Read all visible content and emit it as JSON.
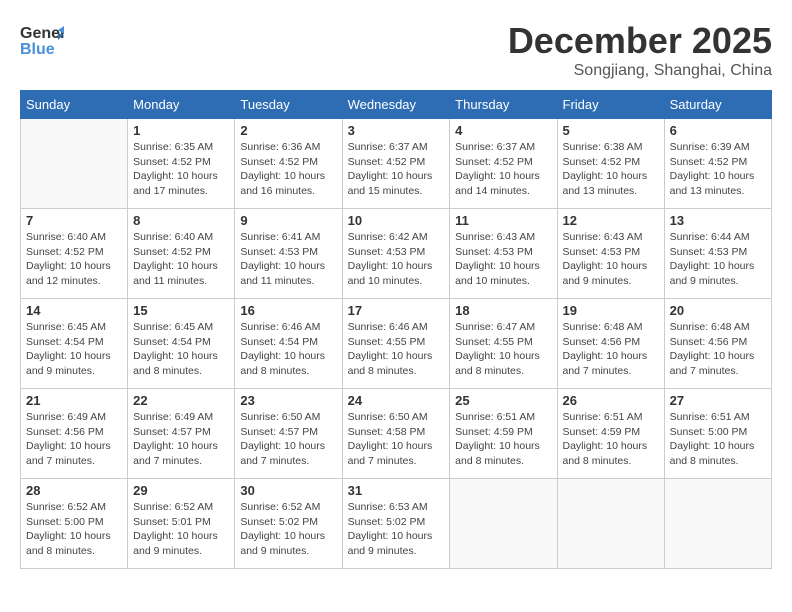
{
  "header": {
    "logo_general": "General",
    "logo_blue": "Blue",
    "month": "December 2025",
    "location": "Songjiang, Shanghai, China"
  },
  "days_of_week": [
    "Sunday",
    "Monday",
    "Tuesday",
    "Wednesday",
    "Thursday",
    "Friday",
    "Saturday"
  ],
  "weeks": [
    [
      {
        "day": "",
        "info": ""
      },
      {
        "day": "1",
        "info": "Sunrise: 6:35 AM\nSunset: 4:52 PM\nDaylight: 10 hours\nand 17 minutes."
      },
      {
        "day": "2",
        "info": "Sunrise: 6:36 AM\nSunset: 4:52 PM\nDaylight: 10 hours\nand 16 minutes."
      },
      {
        "day": "3",
        "info": "Sunrise: 6:37 AM\nSunset: 4:52 PM\nDaylight: 10 hours\nand 15 minutes."
      },
      {
        "day": "4",
        "info": "Sunrise: 6:37 AM\nSunset: 4:52 PM\nDaylight: 10 hours\nand 14 minutes."
      },
      {
        "day": "5",
        "info": "Sunrise: 6:38 AM\nSunset: 4:52 PM\nDaylight: 10 hours\nand 13 minutes."
      },
      {
        "day": "6",
        "info": "Sunrise: 6:39 AM\nSunset: 4:52 PM\nDaylight: 10 hours\nand 13 minutes."
      }
    ],
    [
      {
        "day": "7",
        "info": "Sunrise: 6:40 AM\nSunset: 4:52 PM\nDaylight: 10 hours\nand 12 minutes."
      },
      {
        "day": "8",
        "info": "Sunrise: 6:40 AM\nSunset: 4:52 PM\nDaylight: 10 hours\nand 11 minutes."
      },
      {
        "day": "9",
        "info": "Sunrise: 6:41 AM\nSunset: 4:53 PM\nDaylight: 10 hours\nand 11 minutes."
      },
      {
        "day": "10",
        "info": "Sunrise: 6:42 AM\nSunset: 4:53 PM\nDaylight: 10 hours\nand 10 minutes."
      },
      {
        "day": "11",
        "info": "Sunrise: 6:43 AM\nSunset: 4:53 PM\nDaylight: 10 hours\nand 10 minutes."
      },
      {
        "day": "12",
        "info": "Sunrise: 6:43 AM\nSunset: 4:53 PM\nDaylight: 10 hours\nand 9 minutes."
      },
      {
        "day": "13",
        "info": "Sunrise: 6:44 AM\nSunset: 4:53 PM\nDaylight: 10 hours\nand 9 minutes."
      }
    ],
    [
      {
        "day": "14",
        "info": "Sunrise: 6:45 AM\nSunset: 4:54 PM\nDaylight: 10 hours\nand 9 minutes."
      },
      {
        "day": "15",
        "info": "Sunrise: 6:45 AM\nSunset: 4:54 PM\nDaylight: 10 hours\nand 8 minutes."
      },
      {
        "day": "16",
        "info": "Sunrise: 6:46 AM\nSunset: 4:54 PM\nDaylight: 10 hours\nand 8 minutes."
      },
      {
        "day": "17",
        "info": "Sunrise: 6:46 AM\nSunset: 4:55 PM\nDaylight: 10 hours\nand 8 minutes."
      },
      {
        "day": "18",
        "info": "Sunrise: 6:47 AM\nSunset: 4:55 PM\nDaylight: 10 hours\nand 8 minutes."
      },
      {
        "day": "19",
        "info": "Sunrise: 6:48 AM\nSunset: 4:56 PM\nDaylight: 10 hours\nand 7 minutes."
      },
      {
        "day": "20",
        "info": "Sunrise: 6:48 AM\nSunset: 4:56 PM\nDaylight: 10 hours\nand 7 minutes."
      }
    ],
    [
      {
        "day": "21",
        "info": "Sunrise: 6:49 AM\nSunset: 4:56 PM\nDaylight: 10 hours\nand 7 minutes."
      },
      {
        "day": "22",
        "info": "Sunrise: 6:49 AM\nSunset: 4:57 PM\nDaylight: 10 hours\nand 7 minutes."
      },
      {
        "day": "23",
        "info": "Sunrise: 6:50 AM\nSunset: 4:57 PM\nDaylight: 10 hours\nand 7 minutes."
      },
      {
        "day": "24",
        "info": "Sunrise: 6:50 AM\nSunset: 4:58 PM\nDaylight: 10 hours\nand 7 minutes."
      },
      {
        "day": "25",
        "info": "Sunrise: 6:51 AM\nSunset: 4:59 PM\nDaylight: 10 hours\nand 8 minutes."
      },
      {
        "day": "26",
        "info": "Sunrise: 6:51 AM\nSunset: 4:59 PM\nDaylight: 10 hours\nand 8 minutes."
      },
      {
        "day": "27",
        "info": "Sunrise: 6:51 AM\nSunset: 5:00 PM\nDaylight: 10 hours\nand 8 minutes."
      }
    ],
    [
      {
        "day": "28",
        "info": "Sunrise: 6:52 AM\nSunset: 5:00 PM\nDaylight: 10 hours\nand 8 minutes."
      },
      {
        "day": "29",
        "info": "Sunrise: 6:52 AM\nSunset: 5:01 PM\nDaylight: 10 hours\nand 9 minutes."
      },
      {
        "day": "30",
        "info": "Sunrise: 6:52 AM\nSunset: 5:02 PM\nDaylight: 10 hours\nand 9 minutes."
      },
      {
        "day": "31",
        "info": "Sunrise: 6:53 AM\nSunset: 5:02 PM\nDaylight: 10 hours\nand 9 minutes."
      },
      {
        "day": "",
        "info": ""
      },
      {
        "day": "",
        "info": ""
      },
      {
        "day": "",
        "info": ""
      }
    ]
  ]
}
